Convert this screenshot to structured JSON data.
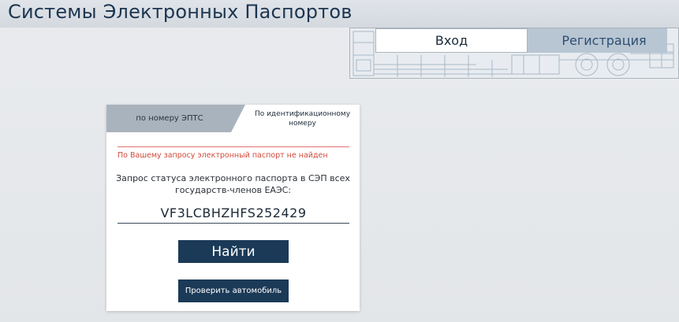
{
  "header": {
    "title": "Системы Электронных Паспортов"
  },
  "auth": {
    "login_label": "Вход",
    "register_label": "Регистрация"
  },
  "search_card": {
    "tabs": [
      {
        "label": "по номеру ЭПТС",
        "active": false
      },
      {
        "label": "По идентификационному номеру",
        "active": true
      }
    ],
    "error_message": "По Вашему запросу электронный паспорт не найден",
    "query_label": "Запрос статуса электронного паспорта в СЭП всех государств-членов ЕАЭС:",
    "vin_value": "VF3LCBHZHFS252429",
    "search_button": "Найти",
    "check_vehicle_button": "Проверить автомобиль"
  },
  "colors": {
    "brand_dark": "#1b3a57",
    "error": "#d04a3a",
    "title": "#1c3550"
  },
  "icons": {
    "auth_background": "truck-blueprint-icon"
  }
}
